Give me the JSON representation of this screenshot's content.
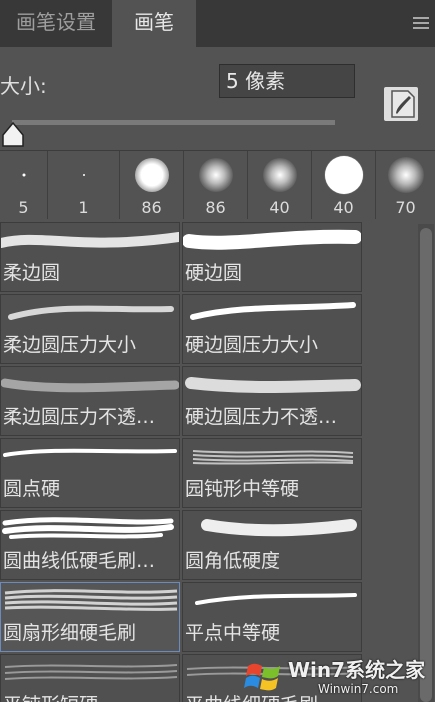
{
  "tabs": [
    {
      "label": "画笔设置"
    },
    {
      "label": "画笔"
    }
  ],
  "size": {
    "label": "大小:",
    "value": "5 像素"
  },
  "presets": [
    {
      "size": "5",
      "tip": 3
    },
    {
      "size": "1",
      "tip": 2
    },
    {
      "size": "86",
      "tip": 34
    },
    {
      "size": "86",
      "tip": 34
    },
    {
      "size": "40",
      "tip": 30
    },
    {
      "size": "40",
      "tip": 38
    },
    {
      "size": "70",
      "tip": 34
    }
  ],
  "brushes": [
    {
      "name": "柔边圆"
    },
    {
      "name": "硬边圆"
    },
    {
      "name": "柔边圆压力大小"
    },
    {
      "name": "硬边圆压力大小"
    },
    {
      "name": "柔边圆压力不透…"
    },
    {
      "name": "硬边圆压力不透…"
    },
    {
      "name": "圆点硬"
    },
    {
      "name": "园钝形中等硬"
    },
    {
      "name": "圆曲线低硬毛刷…"
    },
    {
      "name": "圆角低硬度"
    },
    {
      "name": "圆扇形细硬毛刷"
    },
    {
      "name": "平点中等硬"
    },
    {
      "name": "平钝形短硬"
    },
    {
      "name": "平曲线细硬毛刷"
    }
  ],
  "watermark": {
    "brand": "Win7系统之家",
    "url": "Winwin7.com"
  }
}
